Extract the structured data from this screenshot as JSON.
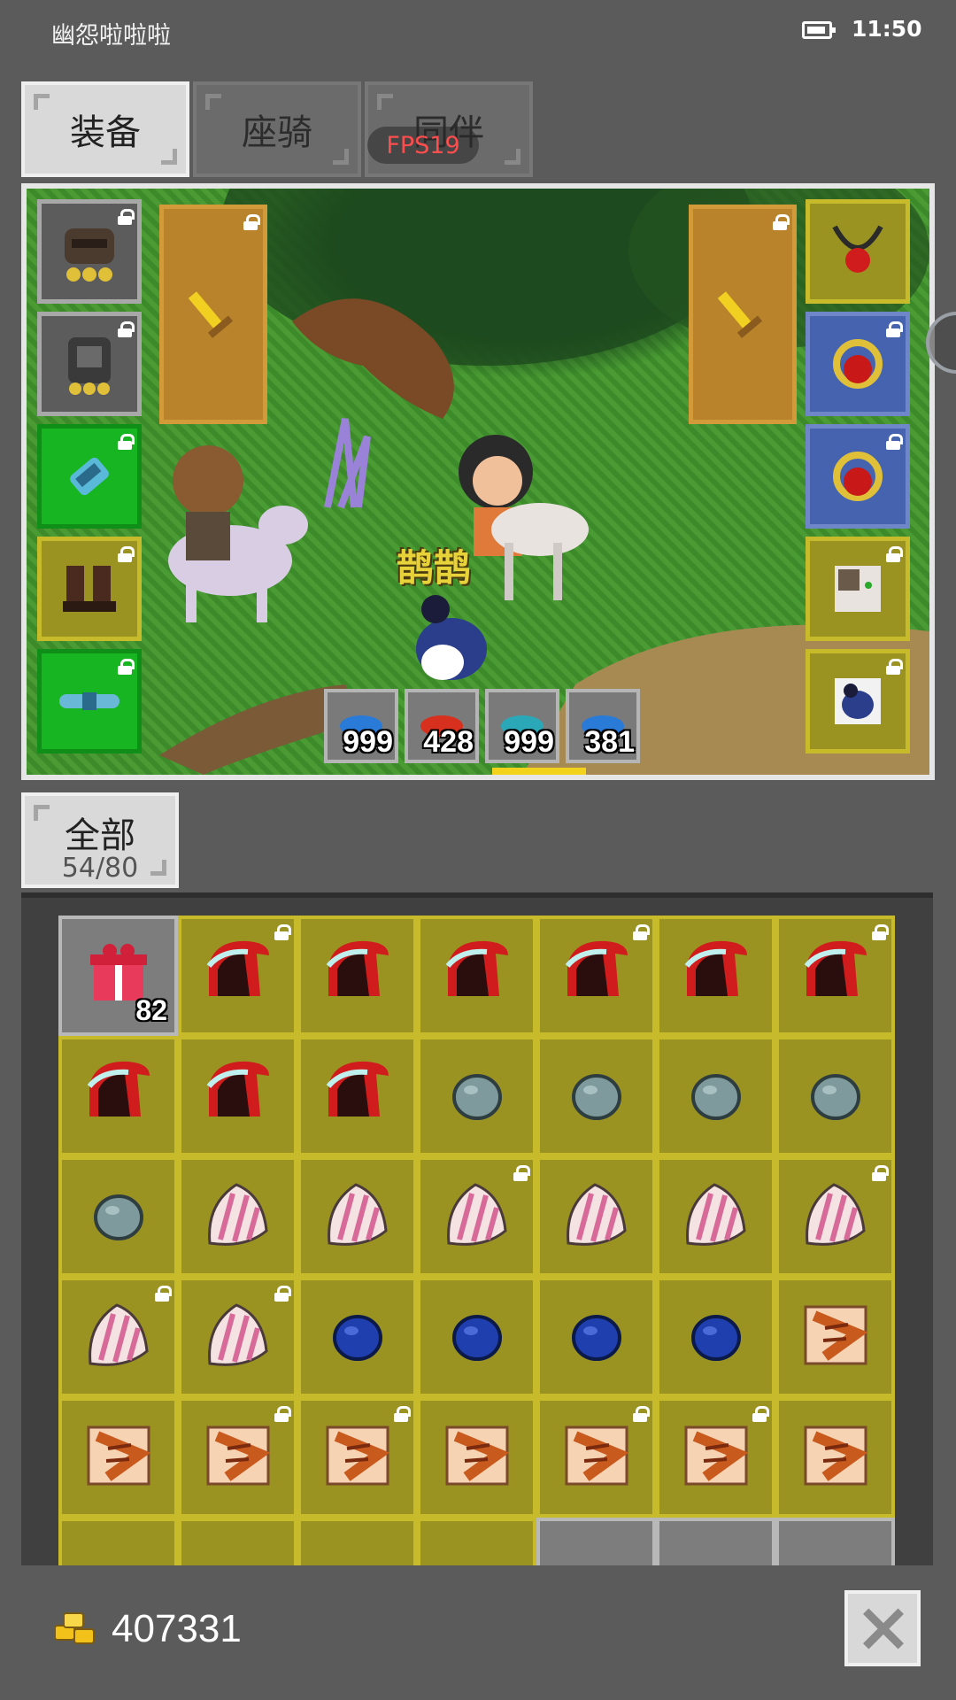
{
  "status_bar": {
    "app_title": "幽怨啦啦啦",
    "time": "11:50",
    "battery_icon": "battery-icon"
  },
  "tabs": [
    {
      "label": "装备",
      "active": true
    },
    {
      "label": "座骑",
      "active": false
    },
    {
      "label": "同伴",
      "active": false
    }
  ],
  "fps_label": "FPS19",
  "scene": {
    "pet_name": "鹊鹊",
    "left_slots": [
      {
        "icon": "helmet-icon",
        "color": "gray",
        "locked": true
      },
      {
        "icon": "armor-icon",
        "color": "gray",
        "locked": true
      },
      {
        "icon": "bracer-icon",
        "color": "green",
        "locked": true
      },
      {
        "icon": "boots-icon",
        "color": "olive",
        "locked": true
      },
      {
        "icon": "belt-icon",
        "color": "green",
        "locked": true
      }
    ],
    "right_slots": [
      {
        "icon": "necklace-icon",
        "color": "olive",
        "locked": false
      },
      {
        "icon": "ring-icon",
        "color": "blue",
        "locked": true
      },
      {
        "icon": "ring-icon",
        "color": "blue",
        "locked": true
      },
      {
        "icon": "mount-icon",
        "color": "olive",
        "locked": true
      },
      {
        "icon": "pet-icon",
        "color": "olive",
        "locked": true
      }
    ],
    "weapons": [
      {
        "icon": "sword-icon",
        "locked": true
      },
      {
        "icon": "sword-icon",
        "locked": true
      }
    ],
    "buffs": [
      {
        "icon": "blue-potion-icon",
        "count": "999"
      },
      {
        "icon": "red-potion-icon",
        "count": "428"
      },
      {
        "icon": "teal-potion-icon",
        "count": "999"
      },
      {
        "icon": "blue-potion-icon",
        "count": "381"
      }
    ]
  },
  "inventory": {
    "tab_label": "全部",
    "capacity": "54/80",
    "items": [
      {
        "icon": "gift-icon",
        "color": "gray",
        "qty": "82",
        "locked": false
      },
      {
        "icon": "red-hood-icon",
        "color": "olive",
        "locked": true
      },
      {
        "icon": "red-hood-icon",
        "color": "olive",
        "locked": false
      },
      {
        "icon": "red-hood-icon",
        "color": "olive",
        "locked": false
      },
      {
        "icon": "red-hood-icon",
        "color": "olive",
        "locked": true
      },
      {
        "icon": "red-hood-icon",
        "color": "olive",
        "locked": false
      },
      {
        "icon": "red-hood-icon",
        "color": "olive",
        "locked": true
      },
      {
        "icon": "red-hood-icon",
        "color": "olive",
        "locked": false
      },
      {
        "icon": "red-hood-icon",
        "color": "olive",
        "locked": false
      },
      {
        "icon": "red-hood-icon",
        "color": "olive",
        "locked": false
      },
      {
        "icon": "gray-stone-icon",
        "color": "olive",
        "locked": false
      },
      {
        "icon": "gray-stone-icon",
        "color": "olive",
        "locked": false
      },
      {
        "icon": "gray-stone-icon",
        "color": "olive",
        "locked": false
      },
      {
        "icon": "gray-stone-icon",
        "color": "olive",
        "locked": false
      },
      {
        "icon": "gray-stone-icon",
        "color": "olive",
        "locked": false
      },
      {
        "icon": "feather-icon",
        "color": "olive",
        "locked": false
      },
      {
        "icon": "feather-icon",
        "color": "olive",
        "locked": false
      },
      {
        "icon": "feather-icon",
        "color": "olive",
        "locked": true
      },
      {
        "icon": "feather-icon",
        "color": "olive",
        "locked": false
      },
      {
        "icon": "feather-icon",
        "color": "olive",
        "locked": false
      },
      {
        "icon": "feather-icon",
        "color": "olive",
        "locked": true
      },
      {
        "icon": "feather-icon",
        "color": "olive",
        "locked": true
      },
      {
        "icon": "feather-icon",
        "color": "olive",
        "locked": true
      },
      {
        "icon": "blue-stone-icon",
        "color": "olive",
        "locked": false
      },
      {
        "icon": "blue-stone-icon",
        "color": "olive",
        "locked": false
      },
      {
        "icon": "blue-stone-icon",
        "color": "olive",
        "locked": false
      },
      {
        "icon": "blue-stone-icon",
        "color": "olive",
        "locked": false
      },
      {
        "icon": "scroll-icon",
        "color": "olive",
        "locked": false
      },
      {
        "icon": "scroll-icon",
        "color": "olive",
        "locked": false
      },
      {
        "icon": "scroll-icon",
        "color": "olive",
        "locked": true
      },
      {
        "icon": "scroll-icon",
        "color": "olive",
        "locked": true
      },
      {
        "icon": "scroll-icon",
        "color": "olive",
        "locked": false
      },
      {
        "icon": "scroll-icon",
        "color": "olive",
        "locked": true
      },
      {
        "icon": "scroll-icon",
        "color": "olive",
        "locked": true
      },
      {
        "icon": "scroll-icon",
        "color": "olive",
        "locked": false
      },
      {
        "icon": "white-item-icon",
        "color": "olive",
        "locked": false
      },
      {
        "icon": "white-item-icon",
        "color": "olive",
        "locked": false
      },
      {
        "icon": "white-item-icon",
        "color": "olive",
        "locked": false
      },
      {
        "icon": "white-item-icon",
        "color": "olive",
        "locked": false
      },
      {
        "icon": "teal-item-icon",
        "color": "gray",
        "locked": false
      },
      {
        "icon": "gold-item-icon",
        "color": "gray",
        "locked": false
      },
      {
        "icon": "gold-item-icon",
        "color": "gray",
        "locked": false
      }
    ]
  },
  "footer": {
    "gold_icon": "gold-coins-icon",
    "gold": "407331",
    "close_icon": "close-icon"
  },
  "colors": {
    "olive": "#9b9321",
    "green": "#17b521",
    "blue": "#4663b0",
    "gray": "#5c5c5c",
    "weapon": "#b8832a"
  }
}
